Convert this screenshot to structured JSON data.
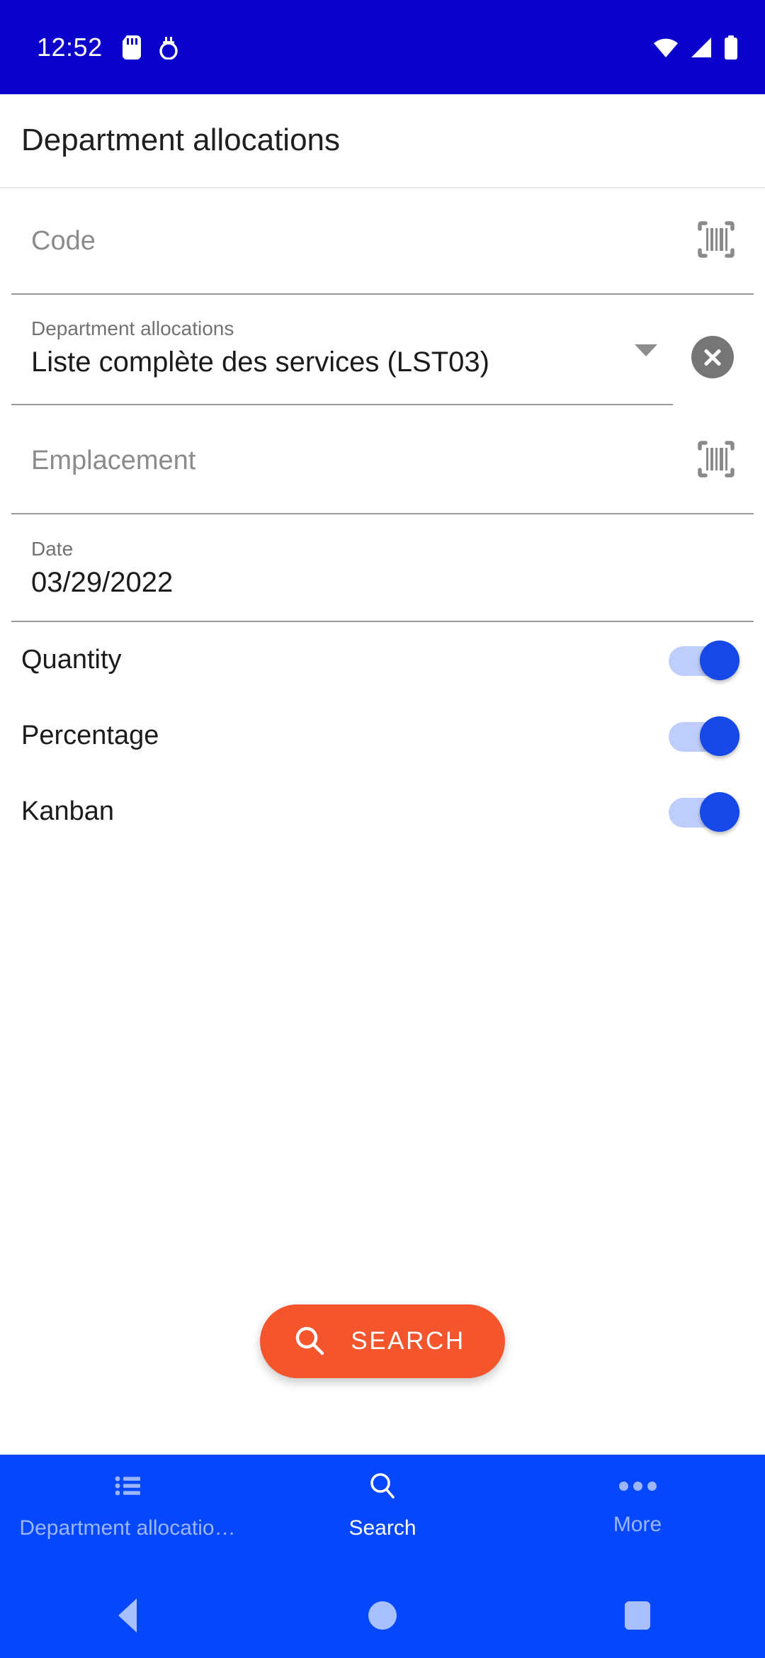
{
  "status_bar": {
    "time": "12:52",
    "icons": [
      "sd-card-icon",
      "usb-debug-icon",
      "wifi-icon",
      "cell-signal-icon",
      "battery-icon"
    ],
    "background": "#0b00cc"
  },
  "app_bar": {
    "title": "Department allocations"
  },
  "form": {
    "code_field": {
      "placeholder": "Code",
      "value": "",
      "scan_icon": "barcode-scan-icon"
    },
    "allocation_select": {
      "label": "Department allocations",
      "value": "Liste complète des services (LST03)",
      "caret_icon": "chevron-down-icon",
      "clear_icon": "clear-circle-icon"
    },
    "location_field": {
      "placeholder": "Emplacement",
      "value": "",
      "scan_icon": "barcode-scan-icon"
    },
    "date_field": {
      "label": "Date",
      "value": "03/29/2022"
    },
    "toggles": [
      {
        "label": "Quantity",
        "on": true
      },
      {
        "label": "Percentage",
        "on": true
      },
      {
        "label": "Kanban",
        "on": true
      }
    ]
  },
  "search_button": {
    "label": "SEARCH",
    "icon": "search-icon",
    "color": "#f4552d"
  },
  "bottom_nav": {
    "background": "#0447fd",
    "items": [
      {
        "label": "Department allocatio…",
        "icon": "list-icon",
        "active": false
      },
      {
        "label": "Search",
        "icon": "search-icon",
        "active": true
      },
      {
        "label": "More",
        "icon": "more-dots-icon",
        "active": false
      }
    ]
  },
  "android_nav": {
    "back": "back-triangle-icon",
    "home": "home-circle-icon",
    "recents": "recents-square-icon"
  }
}
